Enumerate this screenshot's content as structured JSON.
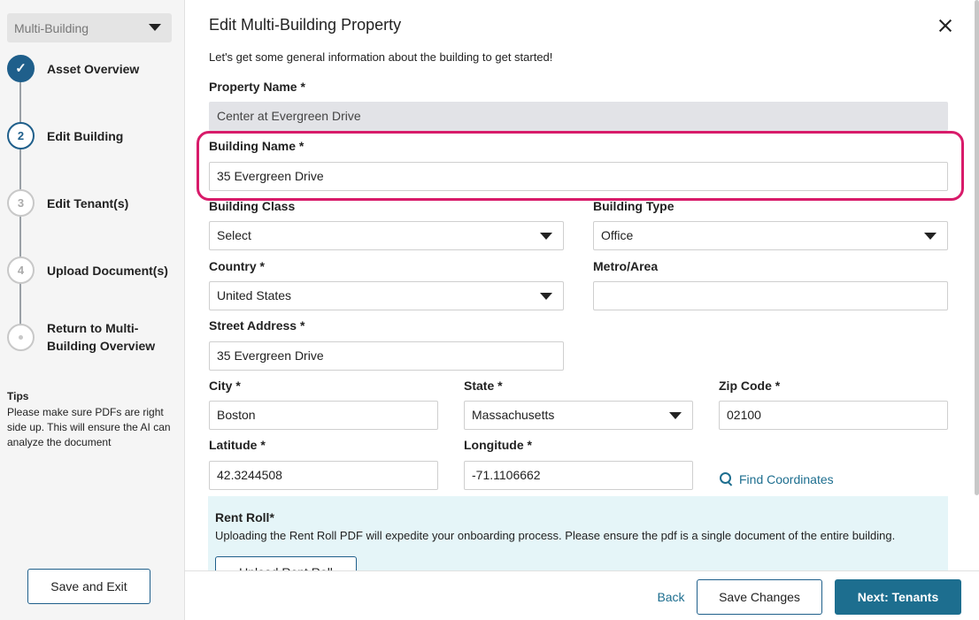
{
  "sidebar": {
    "dropdown_value": "Multi-Building",
    "steps": [
      {
        "marker": "✓",
        "label": "Asset Overview",
        "status": "done"
      },
      {
        "marker": "2",
        "label": "Edit Building",
        "status": "active"
      },
      {
        "marker": "3",
        "label": "Edit Tenant(s)",
        "status": "upcoming"
      },
      {
        "marker": "4",
        "label": "Upload Document(s)",
        "status": "upcoming"
      },
      {
        "marker": "",
        "label": "Return to Multi-Building Overview",
        "status": "upcoming"
      }
    ],
    "tips_title": "Tips",
    "tips_body": "Please make sure PDFs are right side up. This will ensure the AI can analyze the document",
    "save_exit_label": "Save and Exit"
  },
  "form": {
    "title": "Edit Multi-Building Property",
    "intro": "Let's get some general information about the building to get started!",
    "property_name": {
      "label": "Property Name *",
      "value": "Center at Evergreen Drive"
    },
    "building_name": {
      "label": "Building Name *",
      "value": "35 Evergreen Drive"
    },
    "building_class": {
      "label": "Building Class",
      "value": "Select"
    },
    "building_type": {
      "label": "Building Type",
      "value": "Office"
    },
    "country": {
      "label": "Country *",
      "value": "United States"
    },
    "metro_area": {
      "label": "Metro/Area",
      "value": ""
    },
    "street_address": {
      "label": "Street Address *",
      "value": "35 Evergreen Drive"
    },
    "city": {
      "label": "City *",
      "value": "Boston"
    },
    "state": {
      "label": "State *",
      "value": "Massachusetts"
    },
    "zip": {
      "label": "Zip Code *",
      "value": "02100"
    },
    "latitude": {
      "label": "Latitude *",
      "value": "42.3244508"
    },
    "longitude": {
      "label": "Longitude *",
      "value": "-71.1106662"
    },
    "find_coordinates": "Find Coordinates",
    "rent_roll": {
      "title": "Rent Roll*",
      "body": "Uploading the Rent Roll PDF will expedite your onboarding process. Please ensure the pdf is a single document of the entire building.",
      "button": "Upload Rent Roll"
    }
  },
  "footer": {
    "back": "Back",
    "save_changes": "Save Changes",
    "next": "Next: Tenants"
  },
  "colors": {
    "primary": "#1d6e8f",
    "highlight": "#d81b6a",
    "rent_bg": "#e5f5f8"
  }
}
